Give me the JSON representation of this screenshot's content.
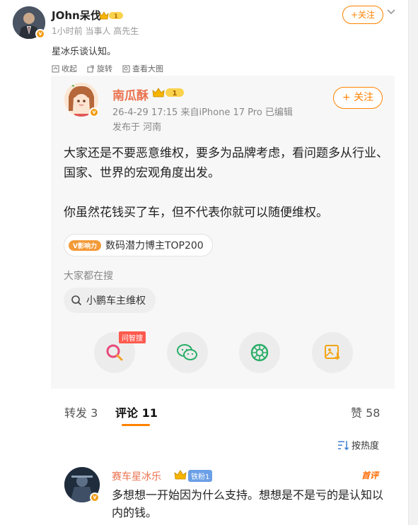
{
  "outer_post": {
    "author": "JOhn呆伐",
    "level": "1",
    "meta": "1小时前  当事人 高先生",
    "follow_label": "+关注",
    "text": "星冰乐谈认知。",
    "tools": [
      "收起",
      "旋转",
      "查看大图"
    ]
  },
  "embedded_post": {
    "author": "南瓜酥",
    "level": "1",
    "follow_label": "+ 关注",
    "meta": "26-4-29 17:15  来自iPhone 17 Pro  已编辑",
    "location": "发布于 河南",
    "body": [
      "大家还是不要恶意维权，要多为品牌考虑，看问题多从行业、国家、世界的宏观角度出发。",
      "你虽然花钱买了车，但不代表你就可以随便维权。"
    ],
    "tag_logo": "V影响力",
    "tag_text": "数码潜力博主TOP200",
    "search_title": "大家都在搜",
    "search_chip": "小鹏车主维权",
    "share_badge": "问智搜",
    "share_icons": [
      "ai-search-icon",
      "wechat-icon",
      "moments-icon",
      "save-image-icon"
    ]
  },
  "stats": {
    "repost": "转发 3",
    "comments": "评论 11",
    "likes": "赞 58",
    "sort": "按热度"
  },
  "comment": {
    "author": "赛车星冰乐",
    "fan_badge": "铁粉1",
    "hot": "首评",
    "text": "多想想一开始因为什么支持。想想是不是亏的是认知以内的钱。"
  },
  "colors": {
    "accent": "#ff8200",
    "name_orange": "#eb7350",
    "badge_blue": "#6b9fe6"
  }
}
